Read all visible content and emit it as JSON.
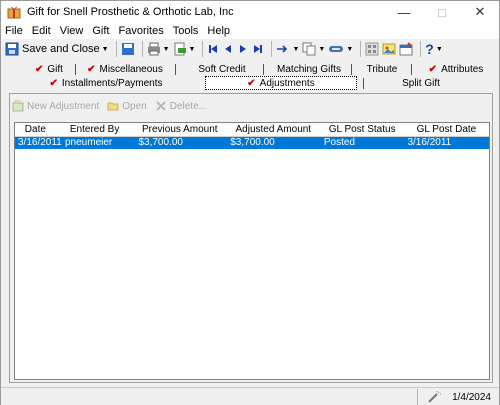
{
  "window": {
    "title": "Gift for Snell Prosthetic & Orthotic Lab, Inc",
    "minimize": "—",
    "maximize": "□",
    "close": "✕"
  },
  "menu": [
    "File",
    "Edit",
    "View",
    "Gift",
    "Favorites",
    "Tools",
    "Help"
  ],
  "toolbar": {
    "save_close_label": "Save and Close",
    "icons": [
      "save-close-icon",
      "save-icon",
      "print-icon",
      "export-icon",
      "first-record-icon",
      "previous-record-icon",
      "next-record-icon",
      "last-record-icon",
      "goto-icon",
      "copy-icon",
      "link-icon",
      "gallery-icon",
      "image-icon",
      "properties-icon",
      "help-icon"
    ],
    "help_label": "?"
  },
  "tabs": {
    "row1": [
      {
        "label": "Gift",
        "checked": true
      },
      {
        "label": "Miscellaneous",
        "checked": true
      },
      {
        "label": "Soft Credit",
        "checked": false
      },
      {
        "label": "Matching Gifts",
        "checked": false
      },
      {
        "label": "Tribute",
        "checked": false
      },
      {
        "label": "Attributes",
        "checked": true
      }
    ],
    "row2": [
      {
        "label": "Installments/Payments",
        "checked": true
      },
      {
        "label": "Adjustments",
        "checked": true,
        "active": true
      },
      {
        "label": "Split Gift",
        "checked": false
      }
    ]
  },
  "subtoolbar": {
    "new_adjustment": "New Adjustment",
    "open": "Open",
    "delete": "Delete..."
  },
  "grid": {
    "columns": [
      "Date",
      "Entered By",
      "Previous Amount",
      "Adjusted Amount",
      "GL Post Status",
      "GL Post Date"
    ],
    "rows": [
      [
        "3/16/2011",
        "pneumeier",
        "$3,700.00",
        "$3,700.00",
        "Posted",
        "3/16/2011"
      ]
    ]
  },
  "status": {
    "date": "1/4/2024"
  },
  "colors": {
    "selection": "#0078d7",
    "check": "#d40000"
  }
}
